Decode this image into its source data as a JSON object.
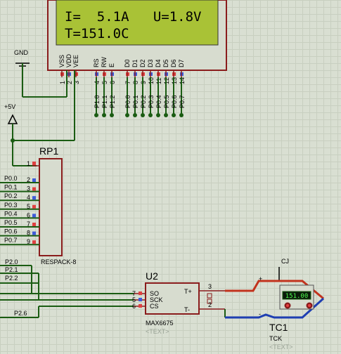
{
  "lcd": {
    "line1": "I=  5.1A   U=1.8V",
    "line2": "T=151.0C",
    "pins": [
      "VSS",
      "VDD",
      "VEE",
      "RS",
      "RW",
      "E",
      "D0",
      "D1",
      "D2",
      "D3",
      "D4",
      "D5",
      "D6",
      "D7"
    ],
    "pin_numbers": [
      "1",
      "2",
      "3",
      "4",
      "5",
      "6",
      "7",
      "8",
      "9",
      "10",
      "11",
      "12",
      "13",
      "14"
    ],
    "net_labels": [
      "P1.0",
      "P1.1",
      "P1.2",
      "P0.0",
      "P0.1",
      "P0.2",
      "P0.3",
      "P0.4",
      "P0.5",
      "P0.6",
      "P0.7"
    ]
  },
  "gnd": {
    "label": "GND"
  },
  "vcc": {
    "label": "+5V"
  },
  "rp1": {
    "ref": "RP1",
    "value": "RESPACK-8",
    "pin1": "1",
    "pins": [
      {
        "net": "P0.0",
        "num": "2"
      },
      {
        "net": "P0.1",
        "num": "3"
      },
      {
        "net": "P0.2",
        "num": "4"
      },
      {
        "net": "P0.3",
        "num": "5"
      },
      {
        "net": "P0.4",
        "num": "6"
      },
      {
        "net": "P0.5",
        "num": "7"
      },
      {
        "net": "P0.6",
        "num": "8"
      },
      {
        "net": "P0.7",
        "num": "9"
      }
    ]
  },
  "nets": {
    "p20": "P2.0",
    "p21": "P2.1",
    "p22": "P2.2",
    "p26": "P2.6"
  },
  "u2": {
    "ref": "U2",
    "value": "MAX6675",
    "text": "<TEXT>",
    "pins_left": [
      {
        "num": "7",
        "name": "SO"
      },
      {
        "num": "5",
        "name": "SCK"
      },
      {
        "num": "6",
        "name": "CS"
      }
    ],
    "pins_right": [
      {
        "num": "3",
        "name": "T+"
      },
      {
        "num": "2",
        "name": "T-"
      }
    ]
  },
  "tc1": {
    "ref": "TC1",
    "value": "TCK",
    "text": "<TEXT>",
    "cj": "CJ",
    "plus": "+",
    "minus": "-",
    "reading": "151.00"
  }
}
